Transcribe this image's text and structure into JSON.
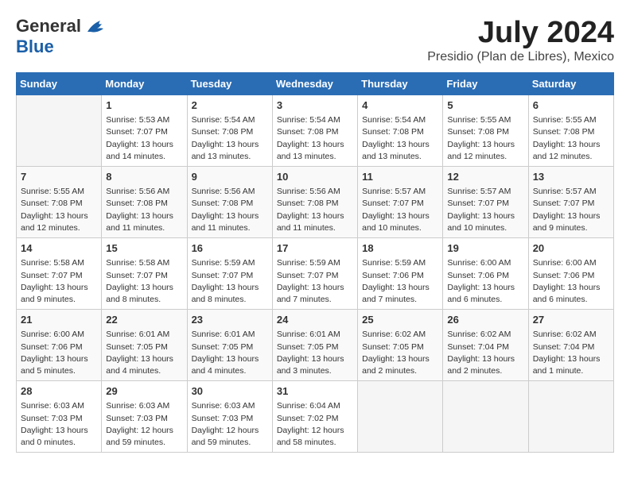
{
  "logo": {
    "general": "General",
    "blue": "Blue"
  },
  "title": {
    "month": "July 2024",
    "location": "Presidio (Plan de Libres), Mexico"
  },
  "headers": [
    "Sunday",
    "Monday",
    "Tuesday",
    "Wednesday",
    "Thursday",
    "Friday",
    "Saturday"
  ],
  "weeks": [
    [
      {
        "day": "",
        "info": ""
      },
      {
        "day": "1",
        "info": "Sunrise: 5:53 AM\nSunset: 7:07 PM\nDaylight: 13 hours\nand 14 minutes."
      },
      {
        "day": "2",
        "info": "Sunrise: 5:54 AM\nSunset: 7:08 PM\nDaylight: 13 hours\nand 13 minutes."
      },
      {
        "day": "3",
        "info": "Sunrise: 5:54 AM\nSunset: 7:08 PM\nDaylight: 13 hours\nand 13 minutes."
      },
      {
        "day": "4",
        "info": "Sunrise: 5:54 AM\nSunset: 7:08 PM\nDaylight: 13 hours\nand 13 minutes."
      },
      {
        "day": "5",
        "info": "Sunrise: 5:55 AM\nSunset: 7:08 PM\nDaylight: 13 hours\nand 12 minutes."
      },
      {
        "day": "6",
        "info": "Sunrise: 5:55 AM\nSunset: 7:08 PM\nDaylight: 13 hours\nand 12 minutes."
      }
    ],
    [
      {
        "day": "7",
        "info": "Sunrise: 5:55 AM\nSunset: 7:08 PM\nDaylight: 13 hours\nand 12 minutes."
      },
      {
        "day": "8",
        "info": "Sunrise: 5:56 AM\nSunset: 7:08 PM\nDaylight: 13 hours\nand 11 minutes."
      },
      {
        "day": "9",
        "info": "Sunrise: 5:56 AM\nSunset: 7:08 PM\nDaylight: 13 hours\nand 11 minutes."
      },
      {
        "day": "10",
        "info": "Sunrise: 5:56 AM\nSunset: 7:08 PM\nDaylight: 13 hours\nand 11 minutes."
      },
      {
        "day": "11",
        "info": "Sunrise: 5:57 AM\nSunset: 7:07 PM\nDaylight: 13 hours\nand 10 minutes."
      },
      {
        "day": "12",
        "info": "Sunrise: 5:57 AM\nSunset: 7:07 PM\nDaylight: 13 hours\nand 10 minutes."
      },
      {
        "day": "13",
        "info": "Sunrise: 5:57 AM\nSunset: 7:07 PM\nDaylight: 13 hours\nand 9 minutes."
      }
    ],
    [
      {
        "day": "14",
        "info": "Sunrise: 5:58 AM\nSunset: 7:07 PM\nDaylight: 13 hours\nand 9 minutes."
      },
      {
        "day": "15",
        "info": "Sunrise: 5:58 AM\nSunset: 7:07 PM\nDaylight: 13 hours\nand 8 minutes."
      },
      {
        "day": "16",
        "info": "Sunrise: 5:59 AM\nSunset: 7:07 PM\nDaylight: 13 hours\nand 8 minutes."
      },
      {
        "day": "17",
        "info": "Sunrise: 5:59 AM\nSunset: 7:07 PM\nDaylight: 13 hours\nand 7 minutes."
      },
      {
        "day": "18",
        "info": "Sunrise: 5:59 AM\nSunset: 7:06 PM\nDaylight: 13 hours\nand 7 minutes."
      },
      {
        "day": "19",
        "info": "Sunrise: 6:00 AM\nSunset: 7:06 PM\nDaylight: 13 hours\nand 6 minutes."
      },
      {
        "day": "20",
        "info": "Sunrise: 6:00 AM\nSunset: 7:06 PM\nDaylight: 13 hours\nand 6 minutes."
      }
    ],
    [
      {
        "day": "21",
        "info": "Sunrise: 6:00 AM\nSunset: 7:06 PM\nDaylight: 13 hours\nand 5 minutes."
      },
      {
        "day": "22",
        "info": "Sunrise: 6:01 AM\nSunset: 7:05 PM\nDaylight: 13 hours\nand 4 minutes."
      },
      {
        "day": "23",
        "info": "Sunrise: 6:01 AM\nSunset: 7:05 PM\nDaylight: 13 hours\nand 4 minutes."
      },
      {
        "day": "24",
        "info": "Sunrise: 6:01 AM\nSunset: 7:05 PM\nDaylight: 13 hours\nand 3 minutes."
      },
      {
        "day": "25",
        "info": "Sunrise: 6:02 AM\nSunset: 7:05 PM\nDaylight: 13 hours\nand 2 minutes."
      },
      {
        "day": "26",
        "info": "Sunrise: 6:02 AM\nSunset: 7:04 PM\nDaylight: 13 hours\nand 2 minutes."
      },
      {
        "day": "27",
        "info": "Sunrise: 6:02 AM\nSunset: 7:04 PM\nDaylight: 13 hours\nand 1 minute."
      }
    ],
    [
      {
        "day": "28",
        "info": "Sunrise: 6:03 AM\nSunset: 7:03 PM\nDaylight: 13 hours\nand 0 minutes."
      },
      {
        "day": "29",
        "info": "Sunrise: 6:03 AM\nSunset: 7:03 PM\nDaylight: 12 hours\nand 59 minutes."
      },
      {
        "day": "30",
        "info": "Sunrise: 6:03 AM\nSunset: 7:03 PM\nDaylight: 12 hours\nand 59 minutes."
      },
      {
        "day": "31",
        "info": "Sunrise: 6:04 AM\nSunset: 7:02 PM\nDaylight: 12 hours\nand 58 minutes."
      },
      {
        "day": "",
        "info": ""
      },
      {
        "day": "",
        "info": ""
      },
      {
        "day": "",
        "info": ""
      }
    ]
  ]
}
